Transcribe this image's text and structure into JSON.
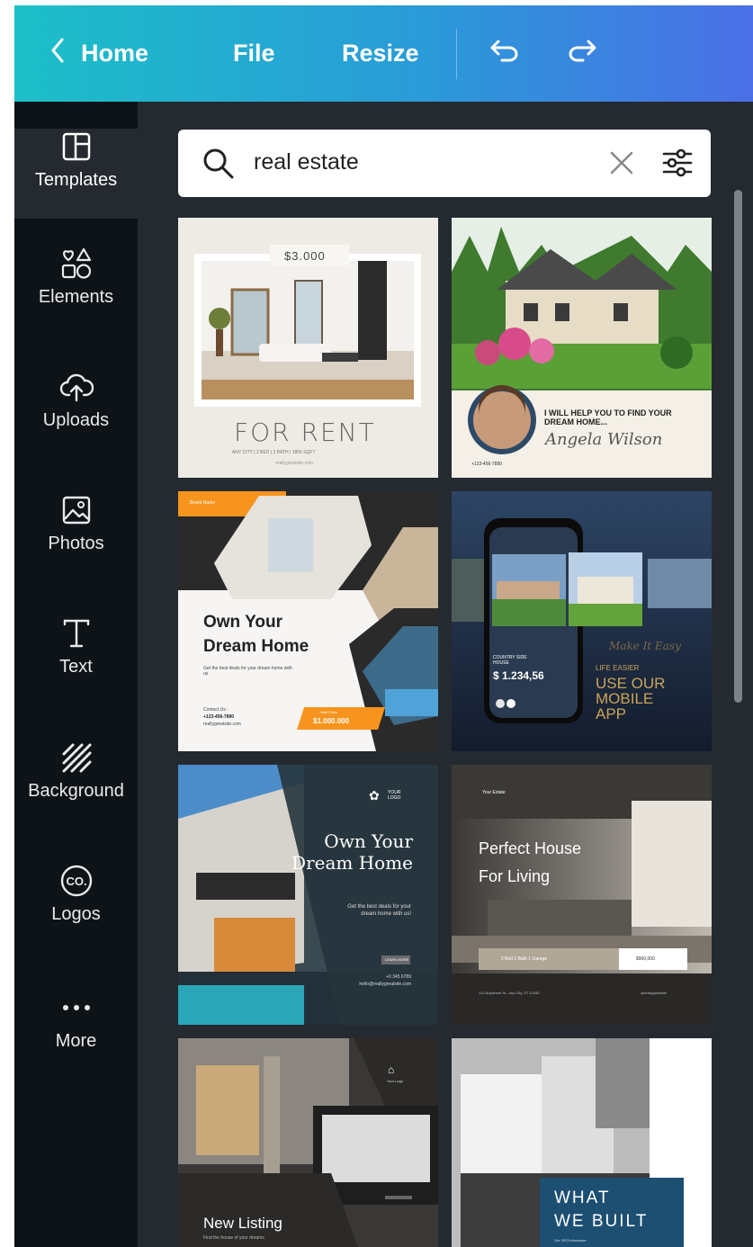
{
  "topbar": {
    "home_label": "Home",
    "file_label": "File",
    "resize_label": "Resize",
    "undo_icon": "undo-icon",
    "redo_icon": "redo-icon"
  },
  "sidebar": {
    "items": [
      {
        "label": "Templates",
        "icon": "templates-icon"
      },
      {
        "label": "Elements",
        "icon": "elements-icon"
      },
      {
        "label": "Uploads",
        "icon": "upload-cloud-icon"
      },
      {
        "label": "Photos",
        "icon": "photo-icon"
      },
      {
        "label": "Text",
        "icon": "text-icon"
      },
      {
        "label": "Background",
        "icon": "background-stripes-icon"
      },
      {
        "label": "Logos",
        "icon": "logo-co-icon"
      },
      {
        "label": "More",
        "icon": "more-dots-icon"
      }
    ],
    "logos_badge": "CO."
  },
  "search": {
    "value": "real estate",
    "icon": "search-icon",
    "clear_icon": "close-icon",
    "filter_icon": "filter-sliders-icon"
  },
  "templates": [
    {
      "price": "$3.000",
      "title": "FOR RENT",
      "details": "ANY CITY | 2 BED | 2 BATH | 1800 SQFT",
      "site": "reallygreatsite.com"
    },
    {
      "headline": "I WILL HELP YOU TO FIND YOUR DREAM HOME...",
      "signature": "Angela Wilson",
      "phone": "+123-456-7890"
    },
    {
      "brand": "Brand Name",
      "title_line1": "Own Your",
      "title_line2": "Dream Home",
      "sub": "Get the best deals for your dream home with us",
      "contact_label": "Contact Us :",
      "contact_phone": "+123-456-7890",
      "contact_site": "reallygreatsite.com",
      "price_label": "Start From",
      "price": "$1.000.000"
    },
    {
      "card_label": "COUNTRY SIDE HOUSE",
      "price": "$ 1.234,56",
      "script": "Make It Easy",
      "tagline": "LIFE EASIER",
      "cta_line1": "USE OUR",
      "cta_line2": "MOBILE",
      "cta_line3": "APP"
    },
    {
      "logo": "YOUR LOGO",
      "title_line1": "Own Your",
      "title_line2": "Dream Home",
      "sub_line1": "Get the best deals for your",
      "sub_line2": "dream home with us!",
      "button": "LEARN MORE",
      "phone": "+0 345 6789",
      "email": "hello@reallygreatsite.com"
    },
    {
      "brand": "Your Estate",
      "title_line1": "Perfect House",
      "title_line2": "For Living",
      "features": "2 Bed  1 Bath  1 Garage",
      "price": "$900,000",
      "address": "123 Anywhere St., Any City, ST 12345",
      "handle": "@reallygreatsite"
    },
    {
      "logo": "Your Logo",
      "title": "New Listing",
      "sub": "Find the house of your dreams"
    },
    {
      "title_line1": "WHAT",
      "title_line2": "WE BUILT",
      "sub": "Our 2023 showcase"
    }
  ]
}
